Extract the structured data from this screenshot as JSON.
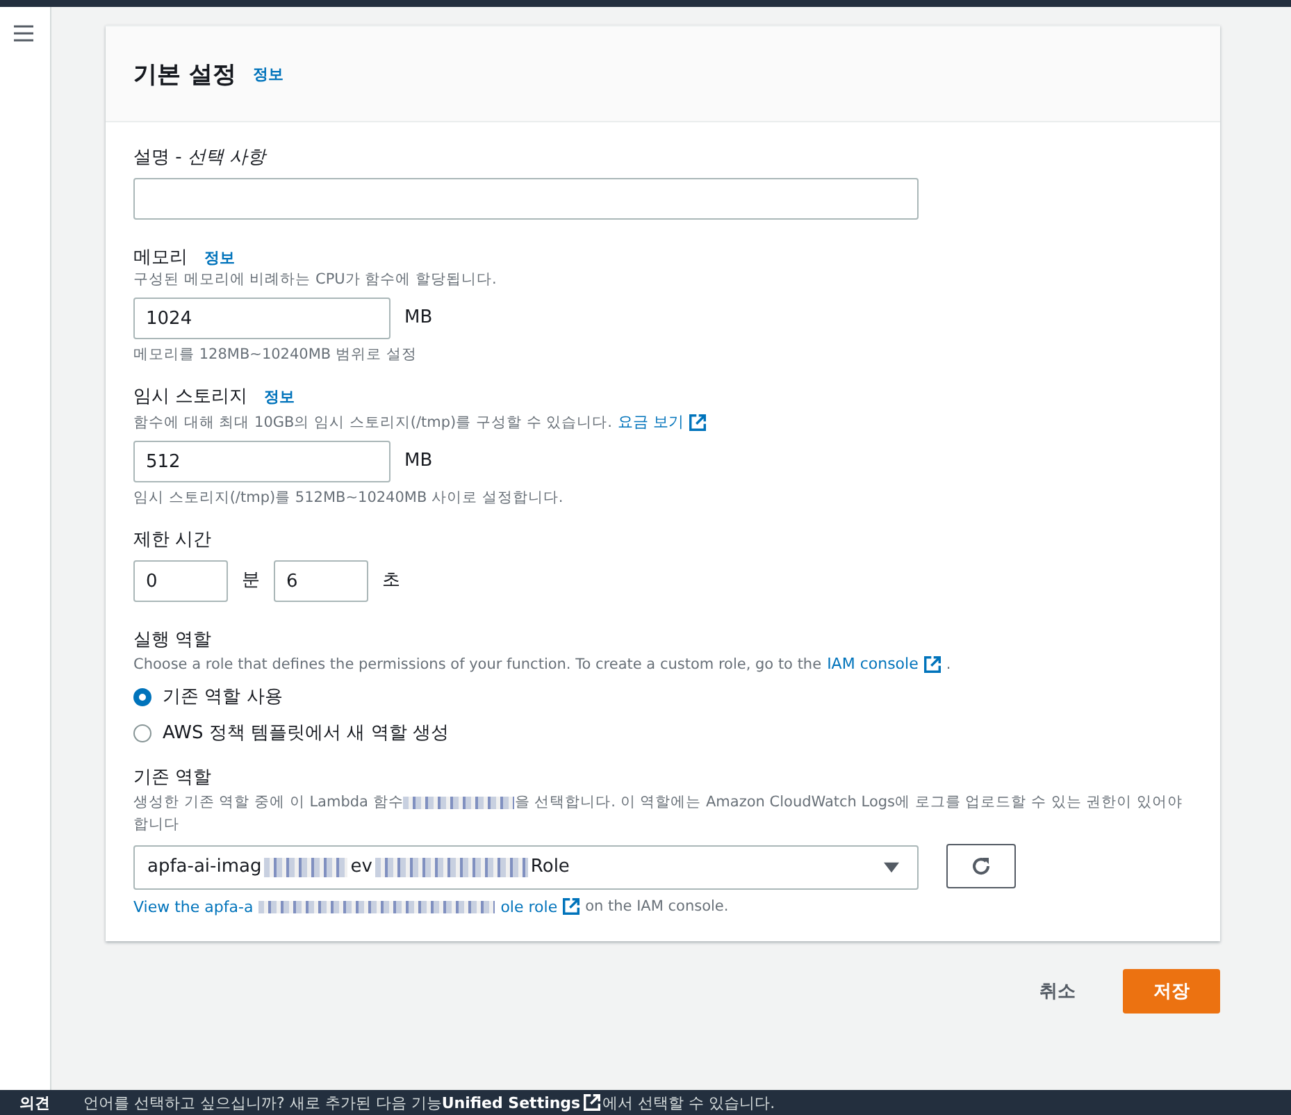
{
  "panel": {
    "title": "기본 설정",
    "info_link": "정보"
  },
  "description": {
    "label": "설명 - ",
    "label_optional": "선택 사항"
  },
  "memory": {
    "label": "메모리",
    "info_link": "정보",
    "hint": "구성된 메모리에 비례하는 CPU가 함수에 할당됩니다.",
    "value": "1024",
    "unit": "MB",
    "constraint": "메모리를 128MB~10240MB 범위로 설정"
  },
  "storage": {
    "label": "임시 스토리지",
    "info_link": "정보",
    "hint": "함수에 대해 최대 10GB의 임시 스토리지(/tmp)를 구성할 수 있습니다.",
    "hint_link": "요금 보기",
    "value": "512",
    "unit": "MB",
    "constraint": "임시 스토리지(/tmp)를 512MB~10240MB 사이로 설정합니다."
  },
  "timeout": {
    "label": "제한 시간",
    "minutes": "0",
    "minutes_unit": "분",
    "seconds": "6",
    "seconds_unit": "초"
  },
  "execution_role": {
    "label": "실행 역할",
    "hint": "Choose a role that defines the permissions of your function. To create a custom role, go to the ",
    "hint_link": "IAM console",
    "hint_end": ".",
    "options": [
      {
        "label": "기존 역할 사용",
        "selected": true
      },
      {
        "label": "AWS 정책 템플릿에서 새 역할 생성",
        "selected": false
      }
    ]
  },
  "existing_role": {
    "label": "기존 역할",
    "hint_start": "생성한 기존 역할 중에 이 Lambda 함수",
    "hint_end": "을 선택합니다. 이 역할에는 Amazon CloudWatch Logs에 로그를 업로드할 수 있는 권한이 있어야 합니다",
    "value_start": "apfa-ai-imag",
    "value_mid": "ev",
    "value_end": "Role",
    "view_start": "View the apfa-a",
    "view_link": "ole role",
    "view_end": "on the IAM console."
  },
  "actions": {
    "cancel": "취소",
    "save": "저장"
  },
  "footer": {
    "feedback": "의견",
    "message_start": "언어를 선택하고 싶으십니까? 새로 추가된 다음 기능",
    "message_link": "Unified Settings",
    "message_end": "에서 선택할 수 있습니다."
  }
}
